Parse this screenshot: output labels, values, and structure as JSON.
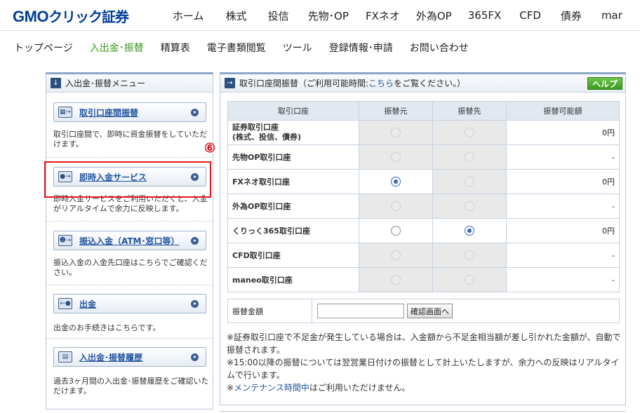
{
  "brand": {
    "gmo": "GMO",
    "click": "クリック証券"
  },
  "global_nav": [
    "ホーム",
    "株式",
    "投信",
    "先物･OP",
    "FXネオ",
    "外為OP",
    "365FX",
    "CFD",
    "債券",
    "mar"
  ],
  "sub_nav": {
    "items": [
      "トップページ",
      "入出金･振替",
      "精算表",
      "電子書類閲覧",
      "ツール",
      "登録情報･申請",
      "お問い合わせ"
    ],
    "active_index": 1
  },
  "left_menu": {
    "title": "入出金･振替メニュー",
    "items": [
      {
        "label": "取引口座間振替",
        "icon": "transfer-icon",
        "desc": "取引口座間で、即時に資金振替をしていただけます。"
      },
      {
        "label": "即時入金サービス",
        "icon": "instant-deposit-icon",
        "desc": "即時入金サービスをご利用いただくと、入金がリアルタイムで余力に反映します。"
      },
      {
        "label": "振込入金（ATM･窓口等）",
        "icon": "atm-icon",
        "desc": "振込入金の入金先口座はこちらでご確認ください。"
      },
      {
        "label": "出金",
        "icon": "withdraw-icon",
        "desc": "出金のお手続きはこちらです。"
      },
      {
        "label": "入出金･振替履歴",
        "icon": "history-icon",
        "desc": "過去3ヶ月間の入出金･振替履歴をご確認いただけます。"
      }
    ]
  },
  "annotation": {
    "marker": "⑥"
  },
  "transfer_panel": {
    "title_pre": "取引口座間振替（ご利用可能時間:",
    "title_link": "こちら",
    "title_post": "をご覧ください。）",
    "help_label": "ヘルプ",
    "columns": [
      "取引口座",
      "振替元",
      "振替先",
      "振替可能額"
    ],
    "rows": [
      {
        "name": "証券取引口座\n(株式、投信、債券)",
        "from": "disabled",
        "to": "disabled",
        "amount": "0円"
      },
      {
        "name": "先物OP取引口座",
        "from": "disabled",
        "to": "disabled",
        "amount": "-"
      },
      {
        "name": "FXネオ取引口座",
        "from": "selected",
        "to": "disabled",
        "amount": "0円"
      },
      {
        "name": "外為OP取引口座",
        "from": "disabled",
        "to": "disabled",
        "amount": "-"
      },
      {
        "name": "くりっく365取引口座",
        "from": "enabled",
        "to": "selected",
        "amount": "0円"
      },
      {
        "name": "CFD取引口座",
        "from": "disabled",
        "to": "disabled",
        "amount": "-"
      },
      {
        "name": "maneo取引口座",
        "from": "disabled",
        "to": "disabled",
        "amount": "-"
      }
    ],
    "amount_label": "振替金額",
    "amount_value": "",
    "confirm_label": "確認画面へ",
    "notes": [
      "※証券取引口座で不足金が発生している場合は、入金額から不足金相当額が差し引かれた金額が、自動で振替されます。",
      "※15:00以降の振替については翌営業日付けの振替として計上いたしますが、余力への反映はリアルタイムで行います。"
    ],
    "note3_pre": "※",
    "note3_link": "メンテナンス時間中",
    "note3_post": "はご利用いただけません。"
  }
}
